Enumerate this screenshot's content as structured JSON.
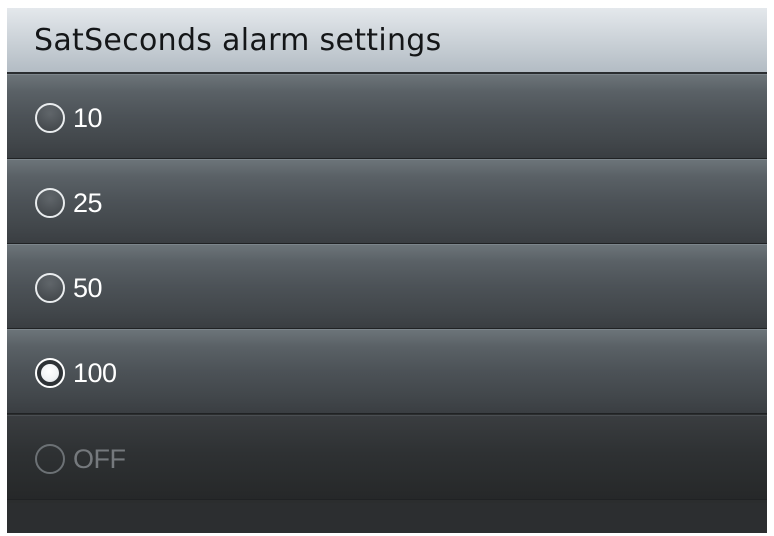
{
  "header": {
    "title": "SatSeconds alarm settings"
  },
  "options": [
    {
      "label": "10",
      "selected": false,
      "enabled": true
    },
    {
      "label": "25",
      "selected": false,
      "enabled": true
    },
    {
      "label": "50",
      "selected": false,
      "enabled": true
    },
    {
      "label": "100",
      "selected": true,
      "enabled": true
    },
    {
      "label": "OFF",
      "selected": false,
      "enabled": false
    }
  ]
}
